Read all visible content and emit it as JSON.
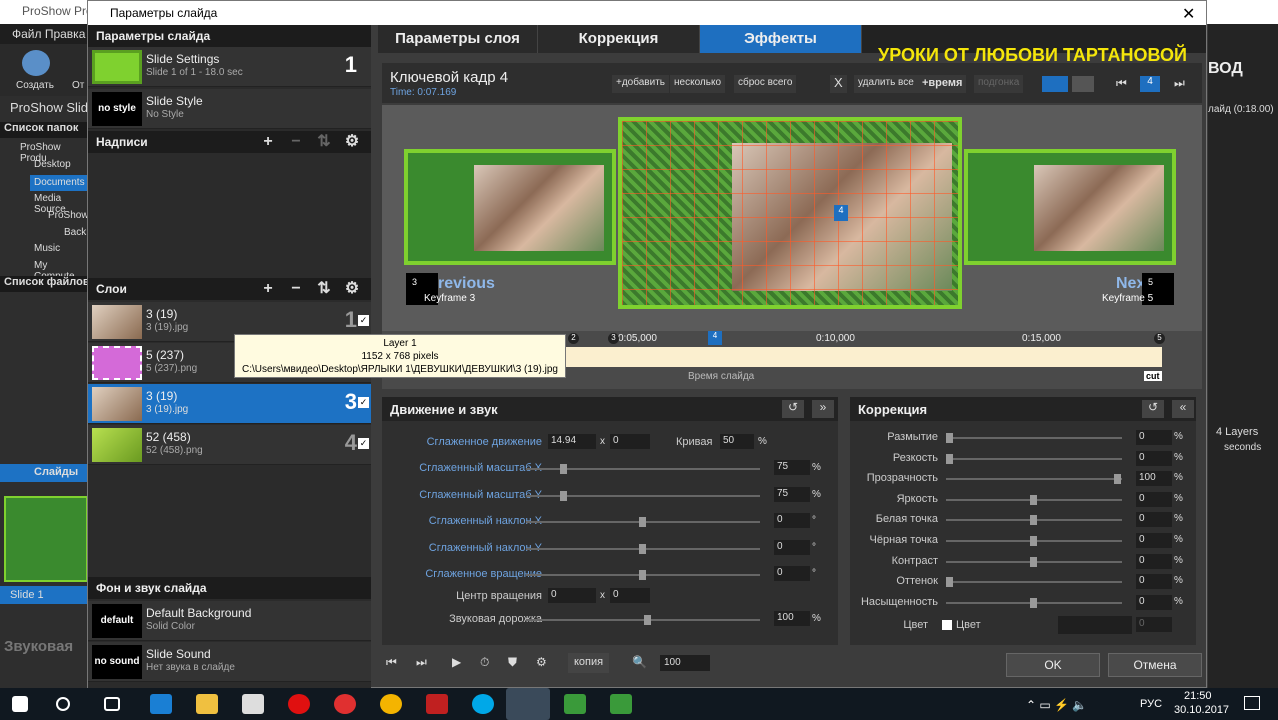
{
  "bg_app": {
    "title": "ProShow Produ",
    "menu": "Файл  Правка",
    "create_label": "Создать",
    "create2_label": "От",
    "proshow_label": "ProShow Slid",
    "folders_header": "Список папок",
    "tree": [
      "ProShow Produ",
      "Desktop",
      "Documents",
      "Media Source",
      "ProShow",
      "Back",
      "Music",
      "My Compute"
    ],
    "files_header": "Список файлов",
    "slides_tab": "Слайды",
    "slide_label": "Slide 1",
    "audio_label": "Звуковая",
    "right_title": "ВОД",
    "right_time": "лайд (0:18.00)",
    "right_layers": "4 Layers",
    "right_seconds": "seconds"
  },
  "dialog": {
    "title": "Параметры слайда",
    "close": "✕"
  },
  "left": {
    "slide_params_header": "Параметры слайда",
    "slide_settings": {
      "title": "Slide Settings",
      "sub": "Slide 1 of 1 - 18.0 sec",
      "num": "1"
    },
    "slide_style": {
      "badge": "no style",
      "title": "Slide Style",
      "sub": "No Style"
    },
    "captions_header": "Надписи",
    "layers_header": "Слои",
    "layers": [
      {
        "title": "3 (19)",
        "sub": "3 (19).jpg",
        "num": "1"
      },
      {
        "title": "5 (237)",
        "sub": "5 (237).png",
        "num": "2"
      },
      {
        "title": "3 (19)",
        "sub": "3 (19).jpg",
        "num": "3"
      },
      {
        "title": "52 (458)",
        "sub": "52 (458).png",
        "num": "4"
      }
    ],
    "bg_header": "Фон и звук слайда",
    "bg": {
      "badge": "default",
      "title": "Default Background",
      "sub": "Solid Color"
    },
    "sound": {
      "badge": "no sound",
      "title": "Slide Sound",
      "sub": "Нет звука в слайде"
    }
  },
  "tooltip": {
    "line1": "Layer 1",
    "line2": "1152 x 768 pixels",
    "line3": "C:\\Users\\мвидео\\Desktop\\ЯРЛЫКИ 1\\ДЕВУШКИ\\ДЕВУШКИ\\3 (19).jpg"
  },
  "tabs": [
    "Параметры слоя",
    "Коррекция",
    "Эффекты"
  ],
  "watermark": "УРОКИ ОТ ЛЮБОВИ ТАРТАНОВОЙ",
  "keyframe": {
    "title": "Ключевой кадр 4",
    "time": "Time: 0:07.169",
    "add": "+добавить",
    "several": "несколько",
    "reset": "сброс всего",
    "delete_x": "X",
    "delete_all": "удалить все",
    "time_btn": "+время",
    "fit": "подгонка",
    "current": "4"
  },
  "preview": {
    "prev_label": "revious",
    "prev_sub": "Keyframe 3",
    "prev_num": "3",
    "next_label": "Nex",
    "next_sub": "Keyframe 5",
    "next_num": "5",
    "marker": "4"
  },
  "timeline": {
    "ticks": [
      "0:05,000",
      "0:10,000",
      "0:15,000"
    ],
    "markers": [
      "2",
      "3",
      "4",
      "5"
    ],
    "label": "Время слайда",
    "cut": "cut"
  },
  "motion": {
    "header": "Движение и звук",
    "smooth_motion": "Сглаженное движение",
    "motion_x": "14.94",
    "x_sep": "x",
    "motion_y": "0",
    "curve_label": "Кривая",
    "curve_value": "50",
    "rows": [
      {
        "label": "Сглаженный масштаб X",
        "value": "75",
        "unit": "%",
        "level": 0.15
      },
      {
        "label": "Сглаженный масштаб Y",
        "value": "75",
        "unit": "%",
        "level": 0.15
      },
      {
        "label": "Сглаженный наклон X",
        "value": "0",
        "unit": "°",
        "level": 0.5
      },
      {
        "label": "Сглаженный наклон Y",
        "value": "0",
        "unit": "°",
        "level": 0.5
      },
      {
        "label": "Сглаженное вращение",
        "value": "0",
        "unit": "°",
        "level": 0.5
      }
    ],
    "center_label": "Центр вращения",
    "center_x": "0",
    "center_y": "0",
    "audio_label": "Звуковая дорожка",
    "audio_value": "100",
    "audio_unit": "%"
  },
  "correction": {
    "header": "Коррекция",
    "rows": [
      {
        "label": "Размытие",
        "value": "0",
        "level": 0.0
      },
      {
        "label": "Резкость",
        "value": "0",
        "level": 0.0
      },
      {
        "label": "Прозрачность",
        "value": "100",
        "level": 1.0
      },
      {
        "label": "Яркость",
        "value": "0",
        "level": 0.5
      },
      {
        "label": "Белая точка",
        "value": "0",
        "level": 0.5
      },
      {
        "label": "Чёрная точка",
        "value": "0",
        "level": 0.5
      },
      {
        "label": "Контраст",
        "value": "0",
        "level": 0.5
      },
      {
        "label": "Оттенок",
        "value": "0",
        "level": 0.0
      },
      {
        "label": "Насыщенность",
        "value": "0",
        "level": 0.5
      }
    ],
    "color_label": "Цвет",
    "color_check_label": "Цвет",
    "color_value": "0",
    "unit": "%"
  },
  "bottom": {
    "copy": "копия",
    "zoom": "100",
    "ok": "OK",
    "cancel": "Отмена"
  },
  "taskbar": {
    "lang": "РУС",
    "time": "21:50",
    "date": "30.10.2017"
  }
}
